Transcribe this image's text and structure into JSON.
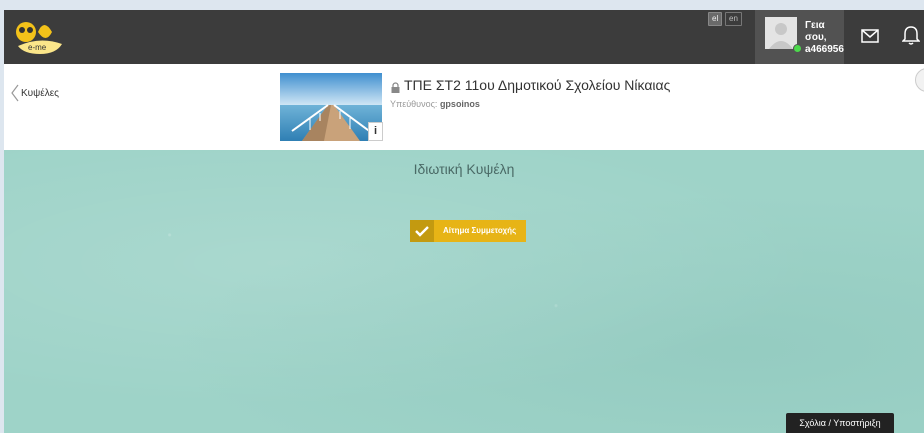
{
  "topbar": {
    "languages": [
      {
        "code": "el",
        "active": true
      },
      {
        "code": "en",
        "active": false
      }
    ],
    "user": {
      "greeting": "Γεια σου,",
      "username": "a466956",
      "online_color": "#4cd94c"
    },
    "icons": [
      "e-me-logo",
      "mail-icon",
      "bell-icon"
    ]
  },
  "header": {
    "back_label": "Κυψέλες",
    "hive_title": "ΤΠΕ ΣΤ2 11ου Δημοτικού Σχολείου Νίκαιας",
    "owner_label": "Υπεύθυνος:",
    "owner_name": "gpsoinos",
    "info_label": "i"
  },
  "main": {
    "private_title": "Ιδιωτική Κυψέλη",
    "join_label": "Αίτημα Συμμετοχής",
    "support_label": "Σχόλια / Υποστήριξη"
  },
  "colors": {
    "topbar": "#3c3c3c",
    "teal": "#9ed3c8",
    "accent": "#e7b416"
  }
}
